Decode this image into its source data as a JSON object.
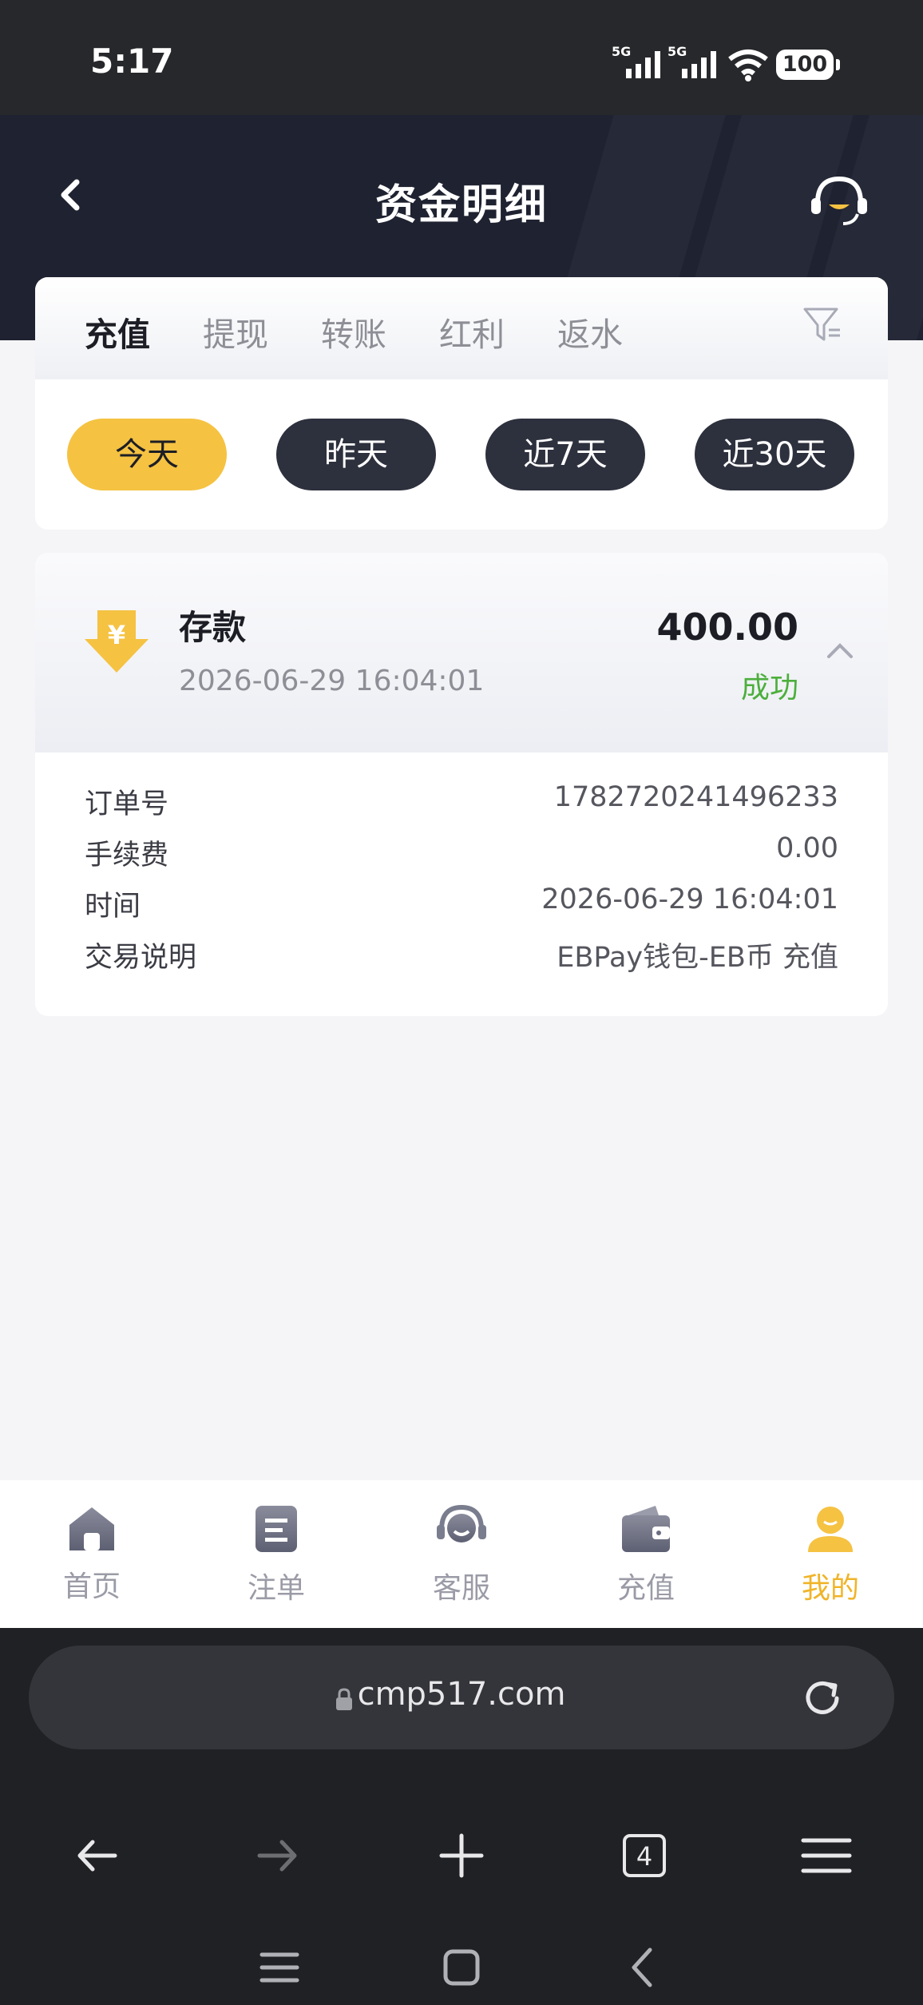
{
  "status_bar": {
    "time": "5:17",
    "network_1": "5G",
    "network_2": "5G",
    "battery": "100"
  },
  "header": {
    "title": "资金明细"
  },
  "tabs": [
    {
      "label": "充值",
      "active": true
    },
    {
      "label": "提现",
      "active": false
    },
    {
      "label": "转账",
      "active": false
    },
    {
      "label": "红利",
      "active": false
    },
    {
      "label": "返水",
      "active": false
    }
  ],
  "date_filters": [
    {
      "label": "今天",
      "active": true
    },
    {
      "label": "昨天",
      "active": false
    },
    {
      "label": "近7天",
      "active": false
    },
    {
      "label": "近30天",
      "active": false
    }
  ],
  "record": {
    "type": "存款",
    "time": "2026-06-29 16:04:01",
    "amount": "400.00",
    "status": "成功",
    "details": [
      {
        "label": "订单号",
        "value": "1782720241496233"
      },
      {
        "label": "手续费",
        "value": "0.00"
      },
      {
        "label": "时间",
        "value": "2026-06-29 16:04:01"
      },
      {
        "label": "交易说明",
        "value": "EBPay钱包-EB币 充值"
      }
    ]
  },
  "bottom_nav": [
    {
      "label": "首页",
      "icon": "home-icon",
      "active": false
    },
    {
      "label": "注单",
      "icon": "bets-icon",
      "active": false
    },
    {
      "label": "客服",
      "icon": "support-icon",
      "active": false
    },
    {
      "label": "充值",
      "icon": "wallet-icon",
      "active": false
    },
    {
      "label": "我的",
      "icon": "profile-icon",
      "active": true
    }
  ],
  "browser": {
    "url": "cmp517.com",
    "tab_count": "4"
  },
  "colors": {
    "accent": "#f5c242",
    "header_bg": "#1f2230",
    "success": "#4caf3c",
    "pill_dark": "#2d303d"
  }
}
